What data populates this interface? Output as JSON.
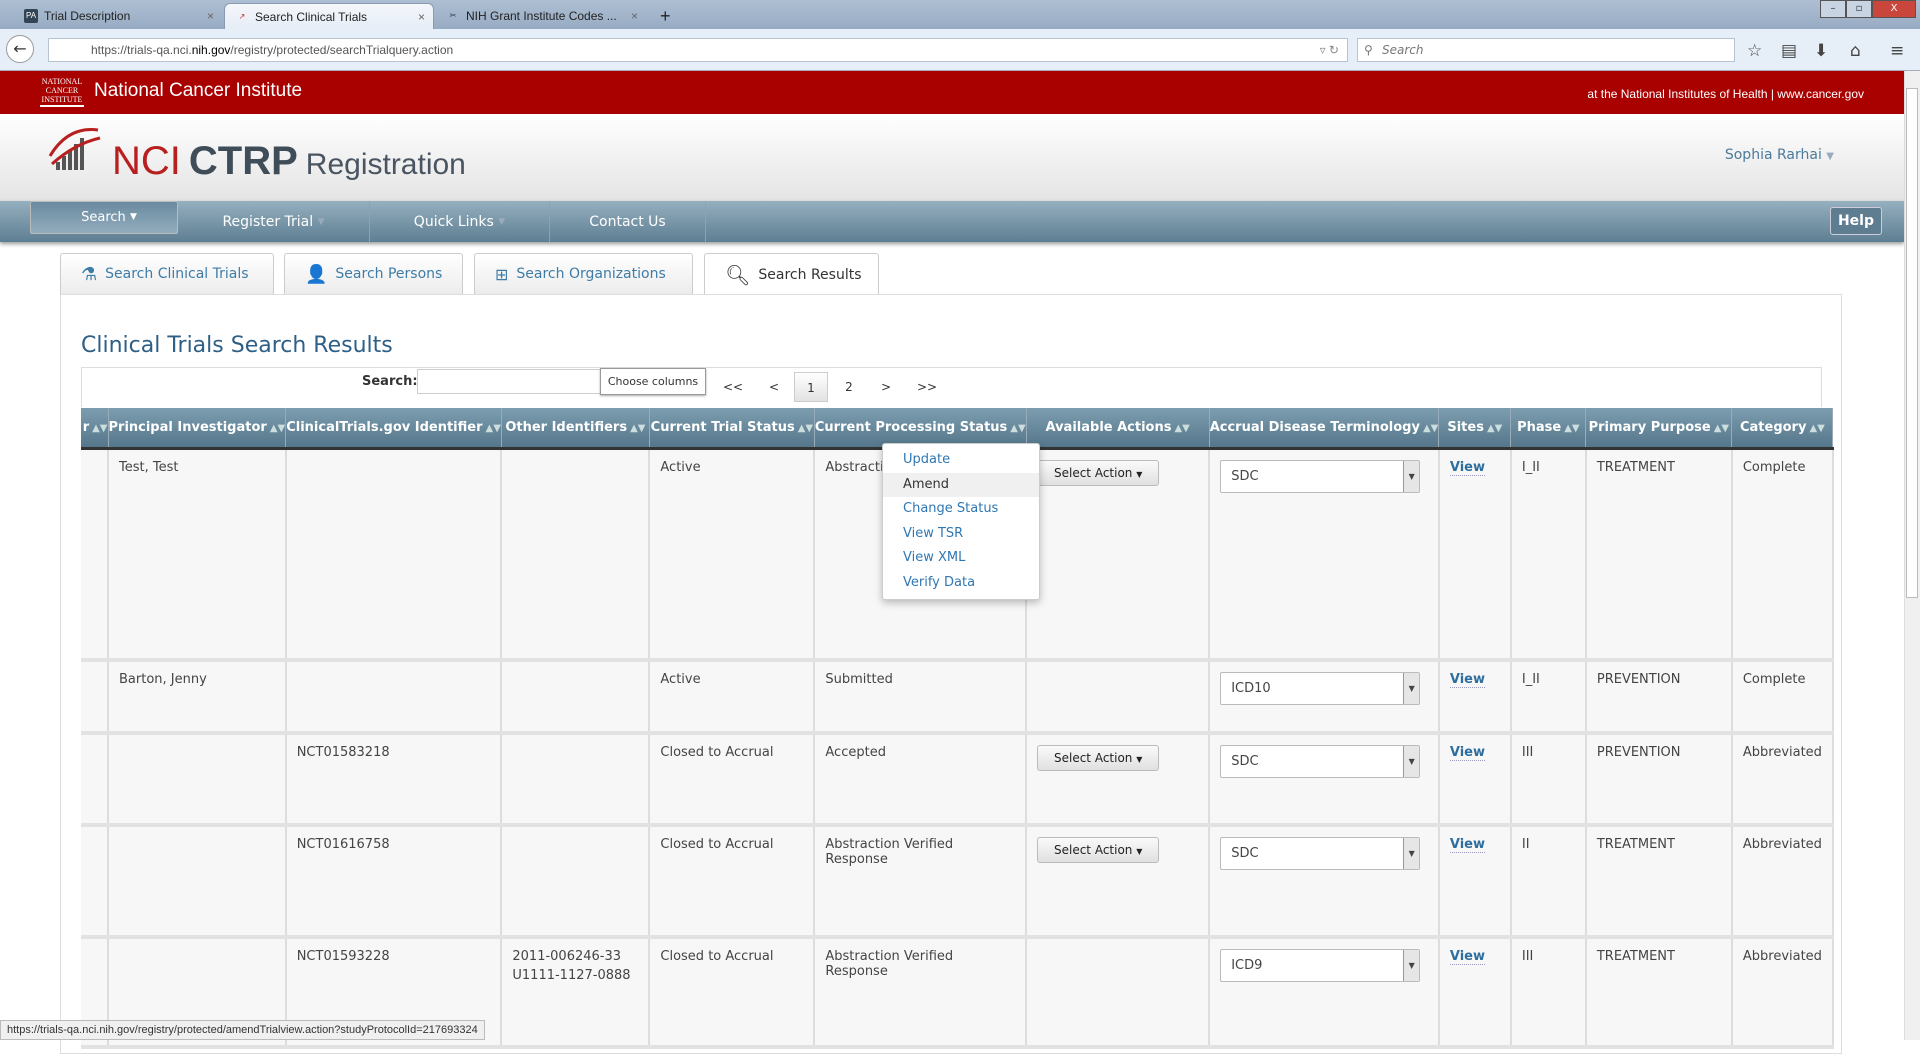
{
  "browser": {
    "tabs": [
      {
        "label": "Trial Description",
        "icon": "PA"
      },
      {
        "label": "Search Clinical Trials"
      },
      {
        "label": "NIH Grant Institute Codes ..."
      }
    ],
    "url_prefix": "https://trials-qa.nci.",
    "url_domain": "nih.gov",
    "url_path": "/registry/protected/searchTrialquery.action",
    "search_placeholder": "Search",
    "status_url": "https://trials-qa.nci.nih.gov/registry/protected/amendTrialview.action?studyProtocolId=217693324",
    "win": {
      "min": "–",
      "max": "▫",
      "close": "X"
    }
  },
  "banner": {
    "logo_text": "NATIONAL CANCER INSTITUTE",
    "name": "National Cancer Institute",
    "tagline": "at the National Institutes of Health | www.cancer.gov"
  },
  "header": {
    "nci": "NCI",
    "ctrp": "CTRP",
    "reg": "Registration",
    "user": "Sophia Rarhai"
  },
  "menu": {
    "items": [
      "Search",
      "Register Trial",
      "Quick Links",
      "Contact Us"
    ],
    "help": "Help"
  },
  "page_tabs": [
    "Search Clinical Trials",
    "Search Persons",
    "Search Organizations",
    "Search Results"
  ],
  "results": {
    "title": "Clinical Trials Search Results",
    "search_label": "Search:",
    "search_value": "",
    "choose_columns": "Choose columns",
    "pager": [
      "<<",
      "<",
      "1",
      "2",
      ">",
      ">>"
    ],
    "columns": [
      "r",
      "Principal Investigator",
      "ClinicalTrials.gov Identifier",
      "Other Identifiers",
      "Current Trial Status",
      "Current Processing Status",
      "Available Actions",
      "Accrual Disease Terminology",
      "Sites",
      "Phase",
      "Primary Purpose",
      "Category"
    ],
    "rows": [
      {
        "pi": "Test, Test",
        "nct": "",
        "other": [
          "",
          ""
        ],
        "status": "Active",
        "proc": "Abstraction",
        "action": "Select Action",
        "term": "SDC",
        "sites": "View",
        "phase": "I_II",
        "purpose": "TREATMENT",
        "cat": "Complete"
      },
      {
        "pi": "Barton, Jenny",
        "nct": "",
        "other": [
          "",
          ""
        ],
        "status": "Active",
        "proc": "Submitted",
        "action": "",
        "term": "ICD10",
        "sites": "View",
        "phase": "I_II",
        "purpose": "PREVENTION",
        "cat": "Complete"
      },
      {
        "pi": "",
        "nct": "NCT01583218",
        "other": [
          "",
          ""
        ],
        "status": "Closed to Accrual",
        "proc": "Accepted",
        "action": "Select Action",
        "term": "SDC",
        "sites": "View",
        "phase": "III",
        "purpose": "PREVENTION",
        "cat": "Abbreviated"
      },
      {
        "pi": "",
        "nct": "NCT01616758",
        "other": [
          "",
          ""
        ],
        "status": "Closed to Accrual",
        "proc": "Abstraction Verified Response",
        "action": "Select Action",
        "term": "SDC",
        "sites": "View",
        "phase": "II",
        "purpose": "TREATMENT",
        "cat": "Abbreviated"
      },
      {
        "pi": "",
        "nct": "NCT01593228",
        "other": [
          "2011-006246-33",
          "U1111-1127-0888"
        ],
        "status": "Closed to Accrual",
        "proc": "Abstraction Verified Response",
        "action": "",
        "term": "ICD9",
        "sites": "View",
        "phase": "III",
        "purpose": "TREATMENT",
        "cat": "Abbreviated"
      }
    ]
  },
  "action_menu": [
    "Update",
    "Amend",
    "Change Status",
    "View TSR",
    "View XML",
    "Verify Data"
  ]
}
